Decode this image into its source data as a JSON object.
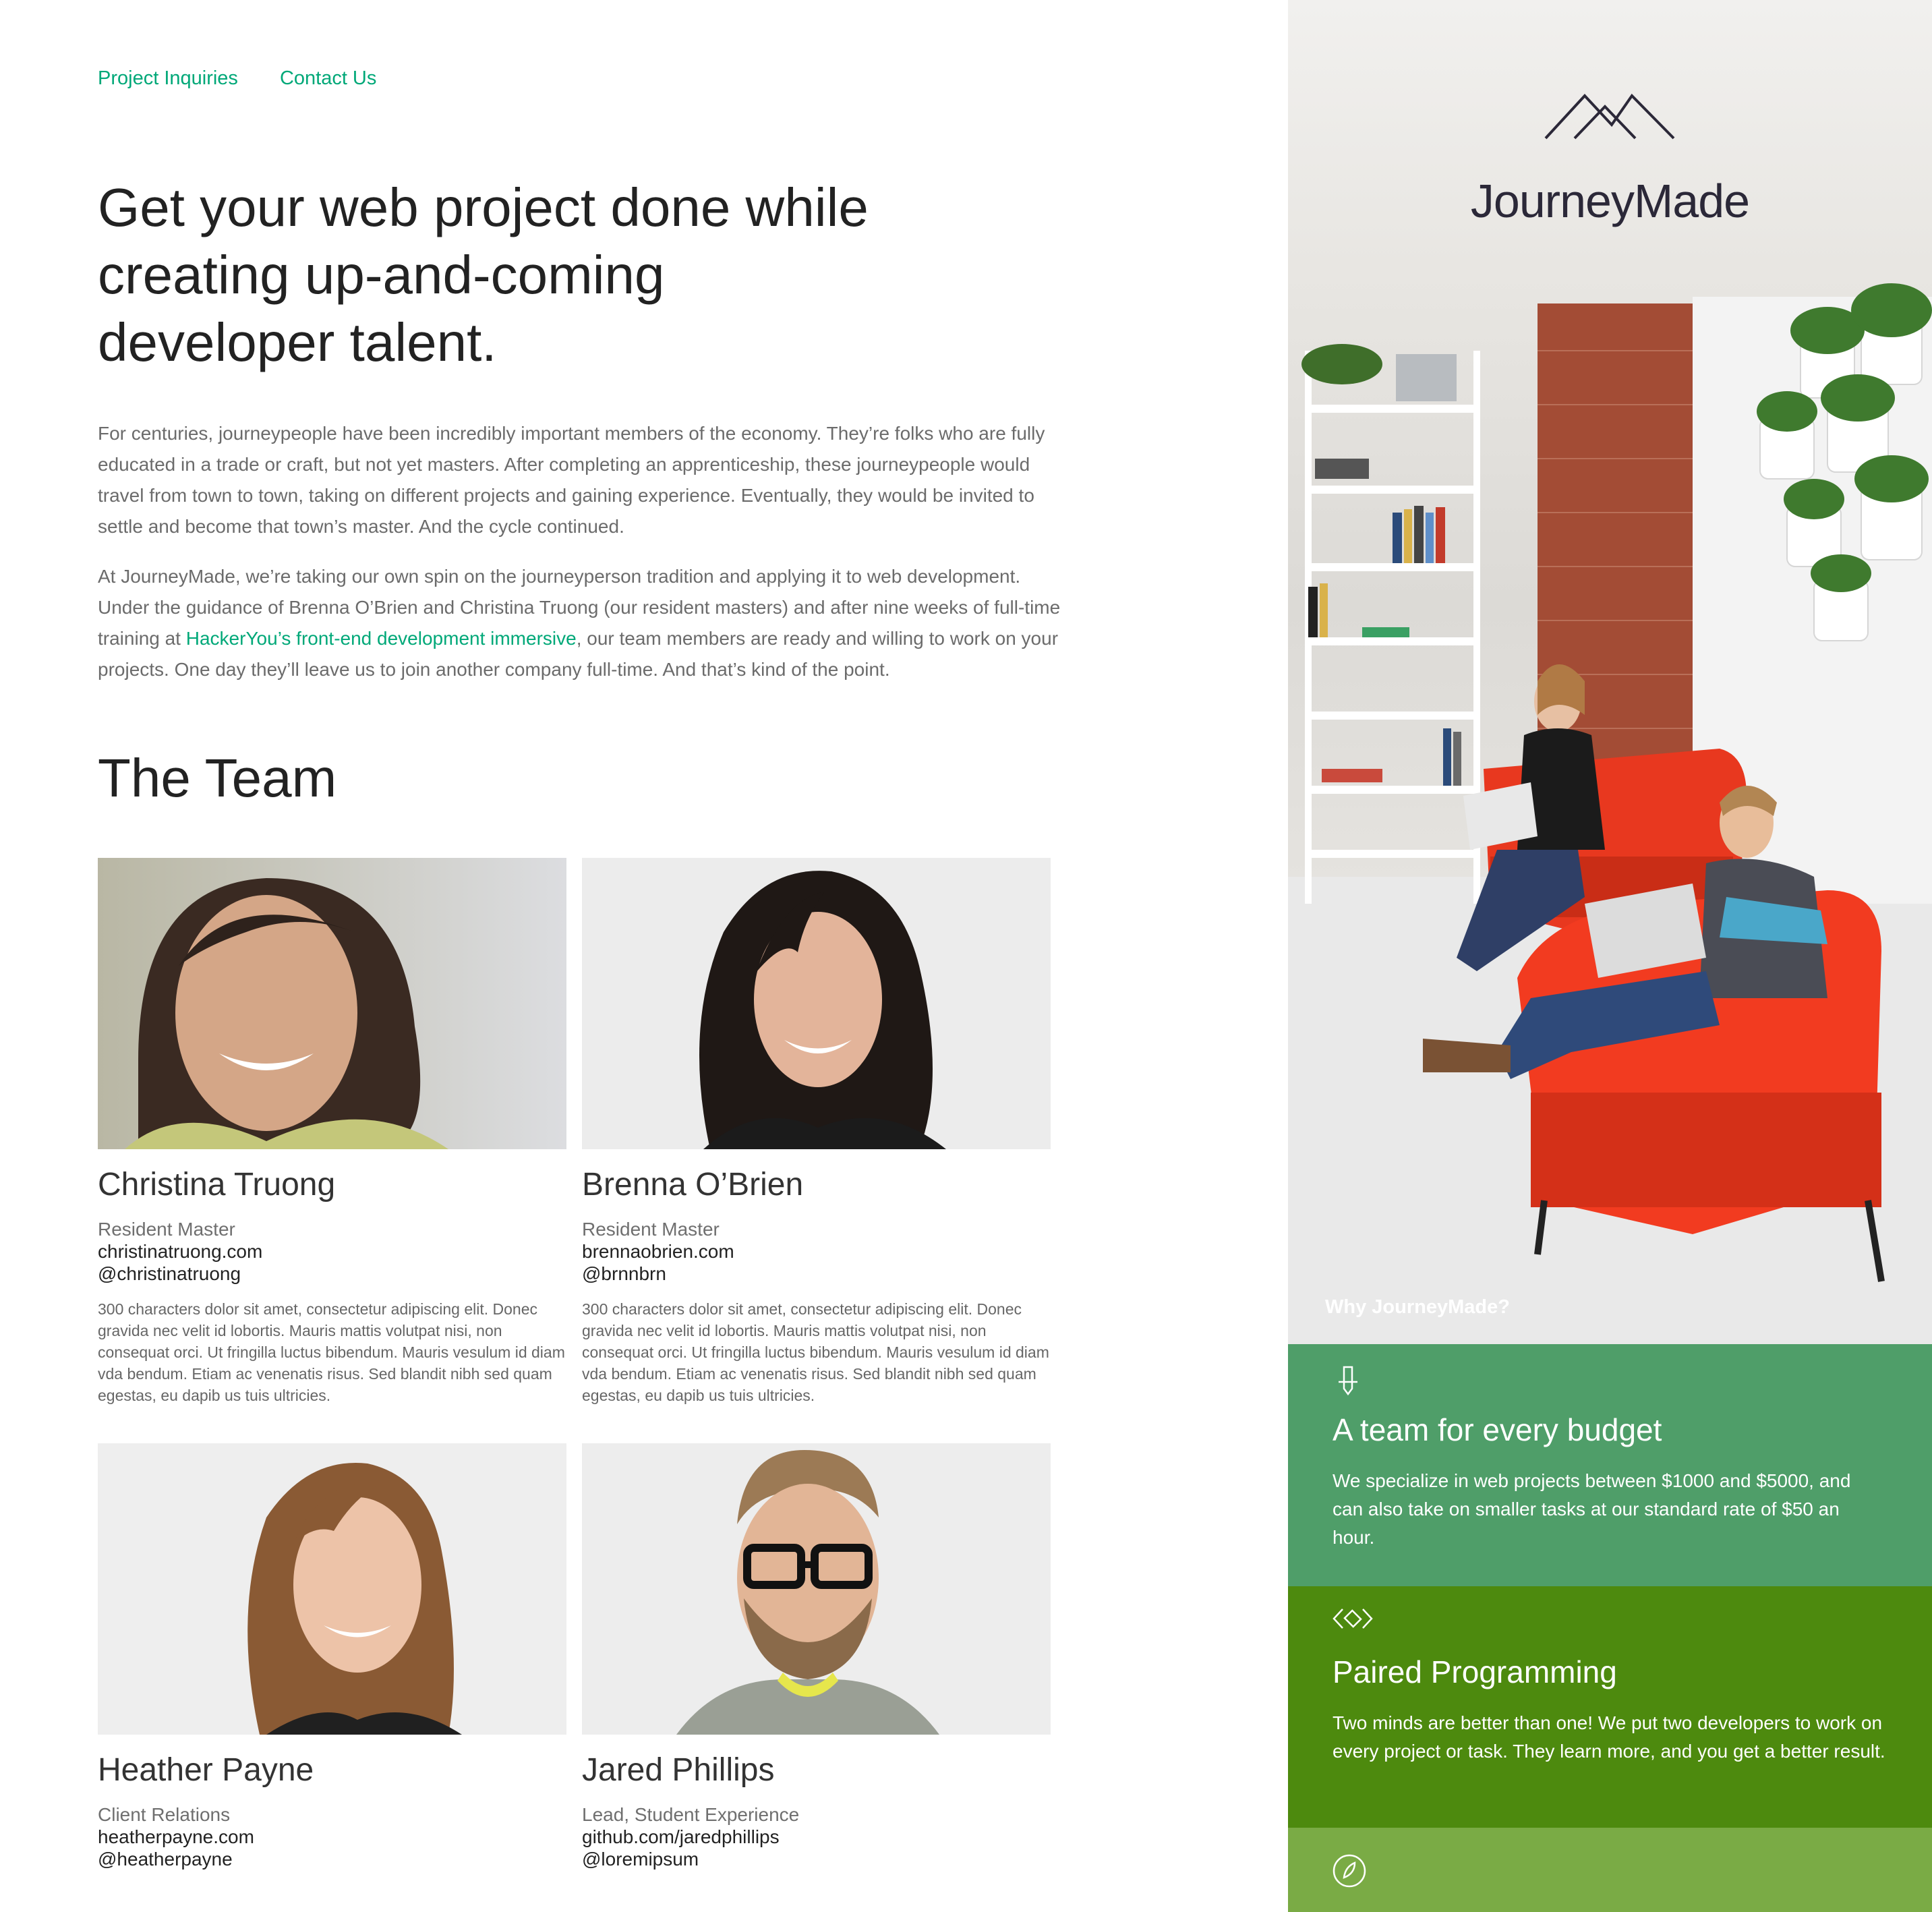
{
  "nav": {
    "links": [
      "Project Inquiries",
      "Contact Us"
    ]
  },
  "headline": "Get your web project done while creating up-and-coming developer talent.",
  "intro": {
    "p1": "For centuries, journeypeople have been incredibly important members of the economy. They’re folks who are fully educated in a trade or craft, but not yet masters. After completing an apprenticeship, these journeypeople would travel from town to town, taking on different projects and gaining experience. Eventually, they would be invited to settle and become that town’s master. And the cycle continued.",
    "p2_before": "At JourneyMade, we’re taking our own spin on the journeyperson tradition and applying it to web development. Under the guidance of Brenna O’Brien and Christina Truong (our resident masters) and after nine weeks of full-time training at ",
    "p2_link": "HackerYou’s front-end development immersive",
    "p2_after": ", our team members are ready and willing to work on your projects. One day they’ll leave us to join another company full-time. And that’s kind of the point."
  },
  "team": {
    "title": "The Team",
    "members": [
      {
        "name": "Christina Truong",
        "role": "Resident Master",
        "site": "christinatruong.com",
        "handle": "@christinatruong",
        "bio": "300 characters dolor sit amet, consectetur adipiscing elit. Donec gravida nec velit id lobortis. Mauris mattis volutpat nisi, non consequat orci. Ut fringilla luctus bibendum. Mauris vesulum id diam vda bendum. Etiam ac venenatis risus. Sed blandit nibh sed quam egestas, eu dapib us tuis ultricies."
      },
      {
        "name": "Brenna O’Brien",
        "role": "Resident Master",
        "site": "brennaobrien.com",
        "handle": "@brnnbrn",
        "bio": "300 characters dolor sit amet, consectetur adipiscing elit. Donec gravida nec velit id lobortis. Mauris mattis volutpat nisi, non consequat orci. Ut fringilla luctus bibendum. Mauris vesulum id diam vda bendum. Etiam ac venenatis risus. Sed blandit nibh sed quam egestas, eu dapib us tuis ultricies."
      },
      {
        "name": "Heather Payne",
        "role": "Client Relations",
        "site": "heatherpayne.com",
        "handle": "@heatherpayne",
        "bio": ""
      },
      {
        "name": "Jared Phillips",
        "role": "Lead, Student Experience",
        "site": "github.com/jaredphillips",
        "handle": "@loremipsum",
        "bio": ""
      }
    ]
  },
  "sidebar": {
    "brand": "JourneyMade",
    "why_label": "Why JourneyMade?",
    "features": [
      {
        "icon": "pencil-icon",
        "title": "A team for every budget",
        "text": "We specialize in web projects between $1000 and $5000, and can also take on smaller tasks at our standard rate of $50 an hour.",
        "color": "#4f9e69"
      },
      {
        "icon": "code-brackets-icon",
        "title": "Paired Programming",
        "text": "Two minds are better than one! We put two developers to work on every project or task. They learn more, and you get a better result.",
        "color": "#4d8a0e"
      },
      {
        "icon": "leaf-icon",
        "title": "",
        "text": "",
        "color": "#7aab45"
      }
    ]
  },
  "colors": {
    "link": "#00a878",
    "heading": "#222222",
    "body": "#6b6b6b"
  }
}
